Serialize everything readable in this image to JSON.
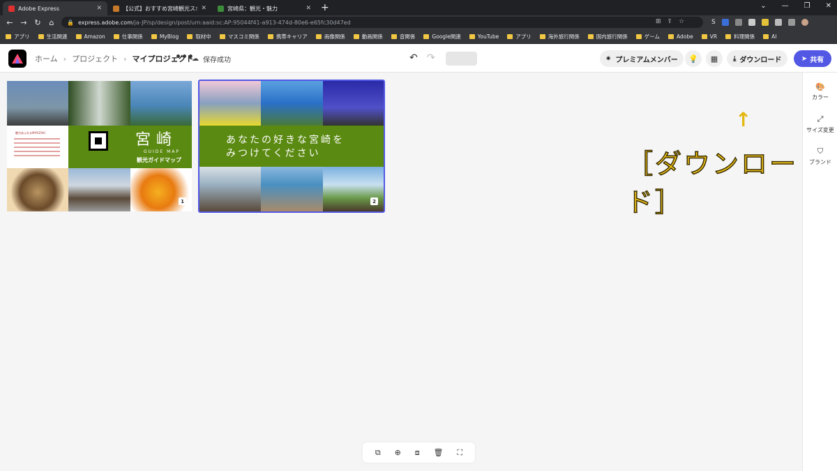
{
  "browser": {
    "tabs": [
      {
        "title": "Adobe Express",
        "close": "✕",
        "favicon_color": "#e03030"
      },
      {
        "title": "【公式】おすすめ宮崎観光スポット／...",
        "close": "✕",
        "favicon_color": "#c47a2a"
      },
      {
        "title": "宮崎県：観光・魅力",
        "close": "✕",
        "favicon_color": "#3c8c3c"
      }
    ],
    "new_tab": "+",
    "url_host": "express.adobe.com",
    "url_path": "/ja-JP/sp/design/post/urn:aaid:sc:AP:95044f41-a913-474d-80e6-e65fc30d47ed",
    "bookmarks": [
      "アプリ",
      "生活関連",
      "Amazon",
      "仕事関係",
      "MyBlog",
      "取材中",
      "マスコミ関係",
      "携帯キャリア",
      "画像関係",
      "動画関係",
      "音関係",
      "Google関連",
      "YouTube",
      "アプリ",
      "海外旅行関係",
      "国内旅行関係",
      "ゲーム",
      "Adobe",
      "VR",
      "料理関係",
      "AI"
    ],
    "profile_initial": "S"
  },
  "header": {
    "breadcrumbs": [
      "ホーム",
      "プロジェクト",
      "マイプロジェクト"
    ],
    "more": "•••",
    "save_status": "保存成功",
    "premium_label": "プレミアムメンバー",
    "download_label": "ダウンロード",
    "share_label": "共有"
  },
  "right_panel": [
    {
      "icon": "palette-icon",
      "label": "カラー"
    },
    {
      "icon": "resize-icon",
      "label": "サイズ変更"
    },
    {
      "icon": "brand-icon",
      "label": "ブランド"
    }
  ],
  "pages": [
    {
      "number": "1",
      "kanji_title": "宮崎",
      "guide_text": "GUIDE MAP",
      "map_title": "観光ガイドマップ",
      "intro_heading": "魅力あふれるMIYAZAKI"
    },
    {
      "number": "2",
      "banner_line1": "あなたの好きな宮崎を",
      "banner_line2": "みつけてください"
    }
  ],
  "annotation": {
    "arrow": "↑",
    "text": "［ダウンロード］",
    "color": "#f2c318"
  },
  "colors": {
    "accent": "#5258e4",
    "banner_green": "#5b8a12"
  }
}
